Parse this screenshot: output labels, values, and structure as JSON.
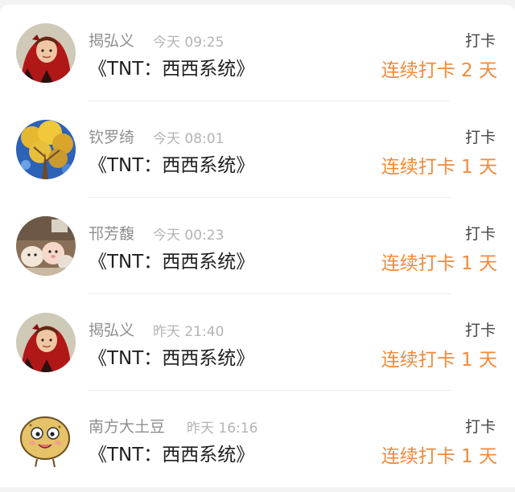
{
  "feed": {
    "items": [
      {
        "name": "揭弘义",
        "time": "今天 09:25",
        "book": "《TNT：西西系统》",
        "action": "打卡",
        "streak": "连续打卡 2 天",
        "avatar": "boy-red-hood-avatar"
      },
      {
        "name": "钦罗绮",
        "time": "今天 08:01",
        "book": "《TNT：西西系统》",
        "action": "打卡",
        "streak": "连续打卡 1 天",
        "avatar": "golden-tree-painting-avatar"
      },
      {
        "name": "邗芳馥",
        "time": "今天 00:23",
        "book": "《TNT：西西系统》",
        "action": "打卡",
        "streak": "连续打卡 1 天",
        "avatar": "plush-toys-avatar"
      },
      {
        "name": "揭弘义",
        "time": "昨天 21:40",
        "book": "《TNT：西西系统》",
        "action": "打卡",
        "streak": "连续打卡 1 天",
        "avatar": "boy-red-hood-avatar"
      },
      {
        "name": "南方大土豆",
        "time": "昨天 16:16",
        "book": "《TNT：西西系统》",
        "action": "打卡",
        "streak": "连续打卡 1 天",
        "avatar": "potato-cartoon-avatar"
      }
    ]
  },
  "colors": {
    "streak": "#f08a3c",
    "name": "#8e8e8e",
    "time": "#b4b4b4",
    "book": "#1f1f1f",
    "action": "#444444"
  }
}
